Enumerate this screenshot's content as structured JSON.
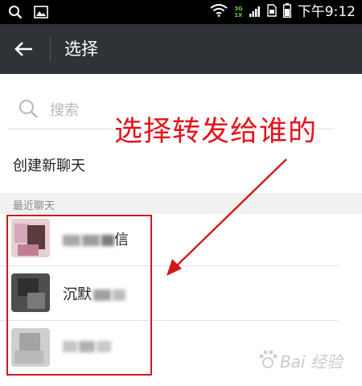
{
  "status_bar": {
    "network_top": "3G",
    "network_bottom": "1X",
    "time": "下午9:12"
  },
  "app_bar": {
    "title": "选择",
    "back_icon": "arrow-left-icon"
  },
  "search": {
    "placeholder": "搜索",
    "icon": "search-icon"
  },
  "annotation": {
    "text": "选择转发给谁的",
    "color": "#e3131b"
  },
  "new_chat": {
    "label": "创建新聊天"
  },
  "recent": {
    "section_label": "最近聊天",
    "items": [
      {
        "name_visible": "信"
      },
      {
        "name_visible": "沉默"
      },
      {
        "name_visible": ""
      }
    ]
  },
  "watermark": {
    "text": "Bai 经验"
  }
}
